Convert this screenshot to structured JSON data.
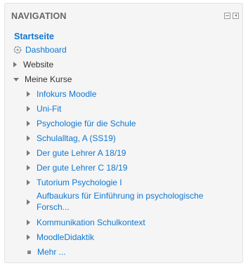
{
  "block": {
    "title": "NAVIGATION",
    "controls": [
      "minimize-icon",
      "dock-icon"
    ]
  },
  "nav": {
    "home": "Startseite",
    "dashboard": "Dashboard",
    "website": "Website",
    "my_courses": "Meine Kurse",
    "courses": [
      "Infokurs Moodle",
      "Uni-Fit",
      "Psychologie für die Schule",
      "Schulalltag, A (SS19)",
      "Der gute Lehrer A 18/19",
      "Der gute Lehrer C 18/19",
      "Tutorium Psychologie I",
      "Aufbaukurs für Einführung in psychologische Forsch...",
      "Kommunikation Schulkontext",
      "MoodleDidaktik"
    ],
    "more": "Mehr ..."
  },
  "colors": {
    "link": "#1177d1",
    "block_bg": "#f5f5f5",
    "title": "#666666"
  }
}
